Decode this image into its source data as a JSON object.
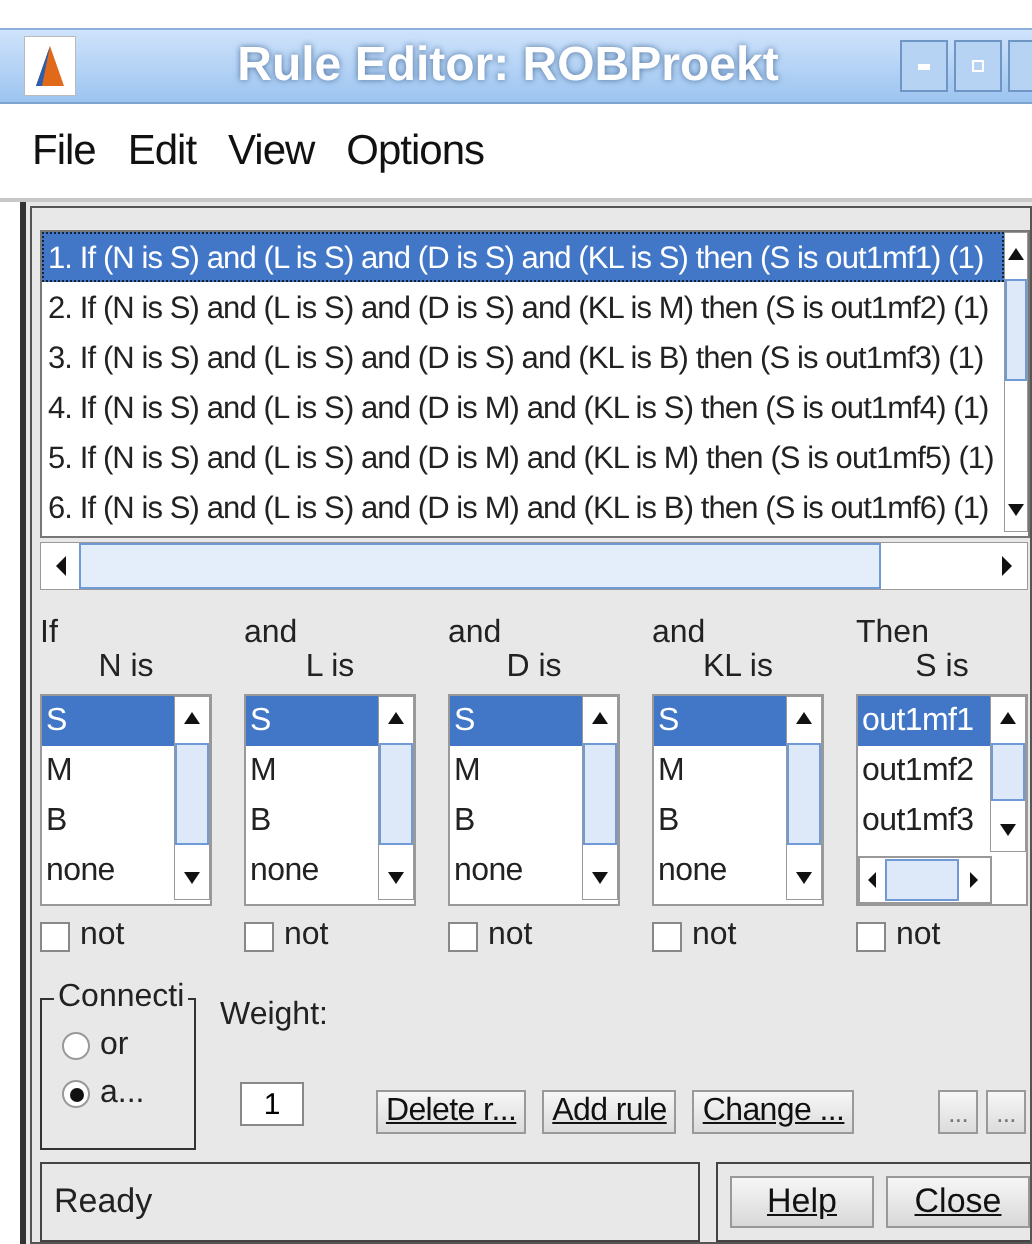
{
  "window": {
    "title": "Rule Editor: ROBProekt"
  },
  "menu": [
    "File",
    "Edit",
    "View",
    "Options"
  ],
  "rules": [
    {
      "text": "1. If (N is S) and (L is S) and (D is S) and (KL is S) then (S is out1mf1) (1)",
      "selected": true
    },
    {
      "text": "2. If (N is S) and (L is S) and (D is S) and (KL is M) then (S is out1mf2) (1)",
      "selected": false
    },
    {
      "text": "3. If (N is S) and (L is S) and (D is S) and (KL is B) then (S is out1mf3) (1)",
      "selected": false
    },
    {
      "text": "4. If (N is S) and (L is S) and (D is M) and (KL is S) then (S is out1mf4) (1)",
      "selected": false
    },
    {
      "text": "5. If (N is S) and (L is S) and (D is M) and (KL is M) then (S is out1mf5) (1)",
      "selected": false
    },
    {
      "text": "6. If (N is S) and (L is S) and (D is M) and (KL is B) then (S is out1mf6) (1)",
      "selected": false
    }
  ],
  "columns": [
    {
      "kind": "input",
      "connective": "If",
      "label": "N is",
      "options": [
        {
          "label": "S",
          "selected": true
        },
        {
          "label": "M",
          "selected": false
        },
        {
          "label": "B",
          "selected": false
        },
        {
          "label": "none",
          "selected": false
        }
      ],
      "not": {
        "label": "not",
        "checked": false
      }
    },
    {
      "kind": "input",
      "connective": "and",
      "label": "L is",
      "options": [
        {
          "label": "S",
          "selected": true
        },
        {
          "label": "M",
          "selected": false
        },
        {
          "label": "B",
          "selected": false
        },
        {
          "label": "none",
          "selected": false
        }
      ],
      "not": {
        "label": "not",
        "checked": false
      }
    },
    {
      "kind": "input",
      "connective": "and",
      "label": "D is",
      "options": [
        {
          "label": "S",
          "selected": true
        },
        {
          "label": "M",
          "selected": false
        },
        {
          "label": "B",
          "selected": false
        },
        {
          "label": "none",
          "selected": false
        }
      ],
      "not": {
        "label": "not",
        "checked": false
      }
    },
    {
      "kind": "input",
      "connective": "and",
      "label": "KL is",
      "options": [
        {
          "label": "S",
          "selected": true
        },
        {
          "label": "M",
          "selected": false
        },
        {
          "label": "B",
          "selected": false
        },
        {
          "label": "none",
          "selected": false
        }
      ],
      "not": {
        "label": "not",
        "checked": false
      }
    },
    {
      "kind": "output",
      "connective": "Then",
      "label": "S is",
      "options": [
        {
          "label": "out1mf1",
          "selected": true
        },
        {
          "label": "out1mf2",
          "selected": false
        },
        {
          "label": "out1mf3",
          "selected": false
        }
      ],
      "not": {
        "label": "not",
        "checked": false
      }
    }
  ],
  "connection": {
    "title": "Connecti",
    "options": [
      {
        "label": "or",
        "selected": false
      },
      {
        "label": "a...",
        "selected": true
      }
    ]
  },
  "weight": {
    "label": "Weight:",
    "value": "1"
  },
  "actions": [
    {
      "label": "Delete r...",
      "disabled": false
    },
    {
      "label": "Add rule",
      "disabled": false
    },
    {
      "label": "Change ...",
      "disabled": false
    }
  ],
  "extra_buttons": [
    {
      "label": "...",
      "disabled": true
    },
    {
      "label": "...",
      "disabled": true
    }
  ],
  "status": "Ready",
  "footer_buttons": [
    "Help",
    "Close"
  ]
}
